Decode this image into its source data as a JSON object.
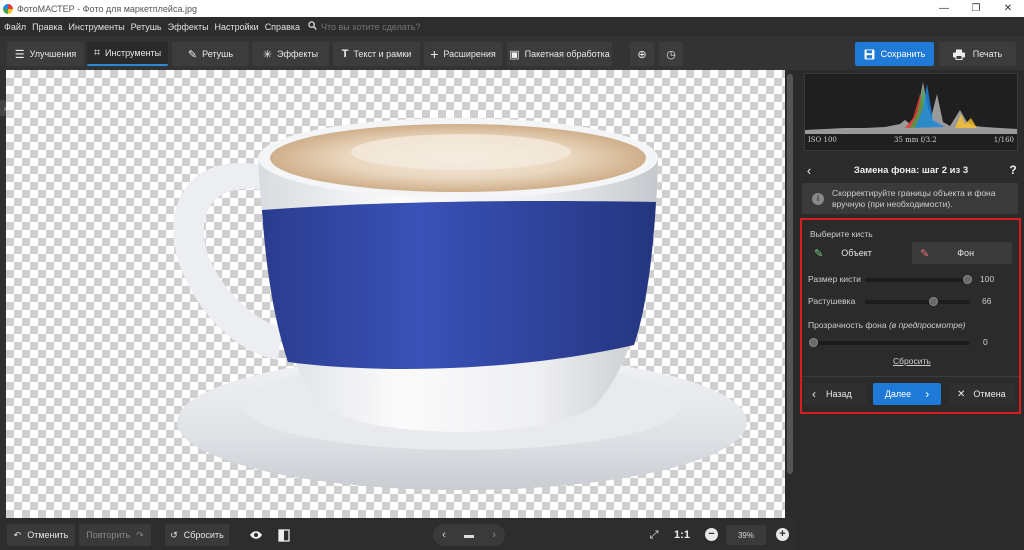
{
  "window": {
    "title": "ФотоМАСТЕР - Фото для маркетплейса.jpg",
    "controls": [
      "—",
      "❐",
      "✕"
    ]
  },
  "menu": {
    "items": [
      "Файл",
      "Правка",
      "Инструменты",
      "Ретушь",
      "Эффекты",
      "Настройки",
      "Справка"
    ],
    "search_placeholder": "Что вы хотите сделать?"
  },
  "toolbar": {
    "tabs": [
      {
        "label": "Улучшения",
        "icon": "sliders-icon"
      },
      {
        "label": "Инструменты",
        "icon": "crop-icon",
        "active": true
      },
      {
        "label": "Ретушь",
        "icon": "brush-icon"
      },
      {
        "label": "Эффекты",
        "icon": "sparkle-icon"
      },
      {
        "label": "Текст и рамки",
        "icon": "text-icon"
      },
      {
        "label": "Расширения",
        "icon": "plus-icon"
      },
      {
        "label": "Пакетная обработка",
        "icon": "images-icon"
      }
    ],
    "save_label": "Сохранить",
    "print_label": "Печать",
    "accent": "#1e7ad6"
  },
  "histogram": {
    "iso": "ISO 100",
    "lens": "35 mm f/3.2",
    "shutter": "1/160"
  },
  "panel": {
    "step_title": "Замена фона: шаг 2 из 3",
    "help_label": "?",
    "info_text_line1": "Скорректируйте границы объекта и фона",
    "info_text_line2": "вручную (при необходимости).",
    "choose_brush_label": "Выберите кисть",
    "brush_object_label": "Объект",
    "brush_background_label": "Фон",
    "brush_size_label": "Размер кисти",
    "brush_size_value": "100",
    "feather_label": "Растушевка",
    "feather_value": "66",
    "bg_opacity_label": "Прозрачность фона",
    "bg_opacity_hint": "(в предпросмотре)",
    "bg_opacity_value": "0",
    "reset_label": "Сбросить",
    "back_label": "Назад",
    "next_label": "Далее",
    "cancel_label": "Отмена",
    "highlight_color": "#d81e1e"
  },
  "bottombar": {
    "undo_label": "Отменить",
    "redo_label": "Повторить",
    "reset_label": "Сбросить",
    "zoom_ratio_label": "1:1",
    "zoom_value": "39%"
  }
}
